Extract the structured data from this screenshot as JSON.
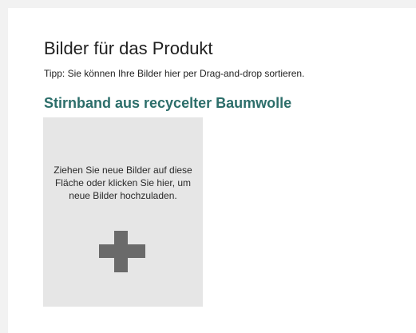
{
  "page": {
    "title": "Bilder für das Produkt",
    "hint": "Tipp: Sie können Ihre Bilder hier per Drag-and-drop sortieren."
  },
  "product": {
    "name": "Stirnband aus recycelter Baumwolle"
  },
  "dropzone": {
    "text": "Ziehen Sie neue Bilder auf diese Fläche oder klicken Sie hier, um neue Bilder hochzuladen.",
    "icon": "plus-icon"
  },
  "colors": {
    "accent": "#2c6e6a",
    "dropzone_bg": "#e6e6e6",
    "icon": "#6a6a6a"
  }
}
